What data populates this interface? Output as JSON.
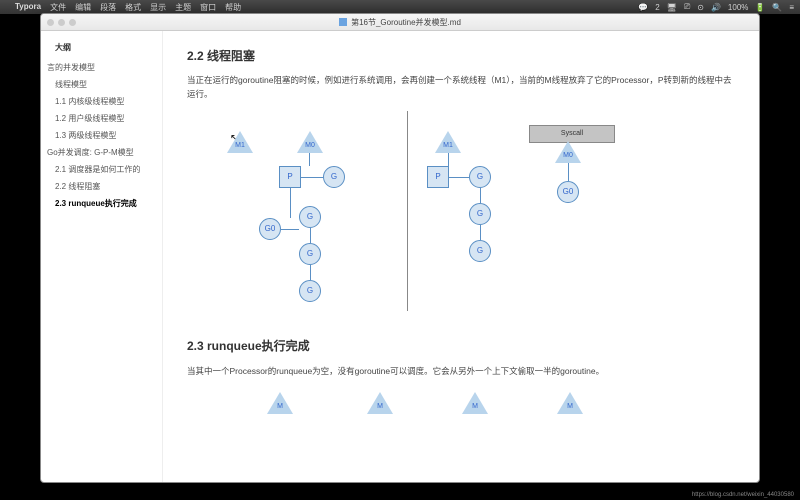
{
  "menubar": {
    "app": "Typora",
    "items": [
      "文件",
      "编辑",
      "段落",
      "格式",
      "显示",
      "主题",
      "窗口",
      "帮助"
    ],
    "right": {
      "wechat": "2",
      "battery": "100%",
      "apple": ""
    }
  },
  "window": {
    "title": "第16节_Goroutine并发模型.md"
  },
  "sidebar": {
    "title": "大纲",
    "items": [
      {
        "label": "言的并发模型",
        "level": 0
      },
      {
        "label": "线程模型",
        "level": 1
      },
      {
        "label": "1.1 内核级线程模型",
        "level": 1
      },
      {
        "label": "1.2 用户级线程模型",
        "level": 1
      },
      {
        "label": "1.3 两级线程模型",
        "level": 1
      },
      {
        "label": "Go并发调度: G-P-M模型",
        "level": 0
      },
      {
        "label": "2.1 调度器是如何工作的",
        "level": 1
      },
      {
        "label": "2.2 线程阻塞",
        "level": 1
      },
      {
        "label": "2.3 runqueue执行完成",
        "level": 1,
        "active": true
      }
    ]
  },
  "content": {
    "h22": "2.2 线程阻塞",
    "p22": "当正在运行的goroutine阻塞的时候，例如进行系统调用，会再创建一个系统线程（M1），当前的M线程放弃了它的Processor，P转到新的线程中去运行。",
    "h23": "2.3 runqueue执行完成",
    "p23": "当其中一个Processor的runqueue为空，没有goroutine可以调度。它会从另外一个上下文偷取一半的goroutine。"
  },
  "labels": {
    "M": "M",
    "M0": "M0",
    "M1": "M1",
    "P": "P",
    "G": "G",
    "G0": "G0",
    "Syscall": "Syscall"
  },
  "watermark": "https://blog.csdn.net/weixin_44030580"
}
